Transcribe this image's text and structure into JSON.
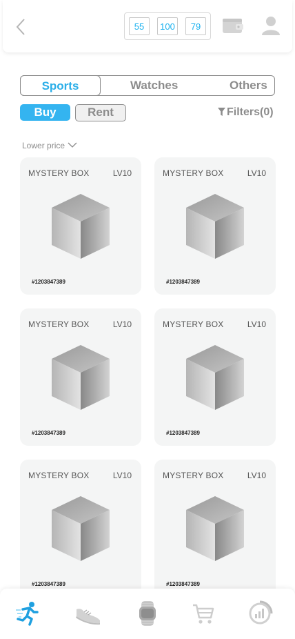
{
  "header": {
    "back_icon": "chevron-left-icon",
    "counters": [
      "55",
      "100",
      "79"
    ],
    "wallet_icon": "wallet-icon",
    "profile_icon": "user-icon"
  },
  "tabs": [
    {
      "label": "Sports",
      "active": true
    },
    {
      "label": "Watches",
      "active": false
    },
    {
      "label": "Others",
      "active": false
    }
  ],
  "mode": {
    "buy_label": "Buy",
    "rent_label": "Rent",
    "selected": "Buy"
  },
  "filters": {
    "label": "Filters(0)",
    "icon": "funnel-icon"
  },
  "sort": {
    "label": "Lower price",
    "icon": "chevron-down-icon"
  },
  "cards": [
    {
      "title": "MYSTERY BOX",
      "level": "LV10",
      "id": "#1203847389",
      "icon": "cube-icon"
    },
    {
      "title": "MYSTERY BOX",
      "level": "LV10",
      "id": "#1203847389",
      "icon": "cube-icon"
    },
    {
      "title": "MYSTERY BOX",
      "level": "LV10",
      "id": "#1203847389",
      "icon": "cube-icon"
    },
    {
      "title": "MYSTERY BOX",
      "level": "LV10",
      "id": "#1203847389",
      "icon": "cube-icon"
    },
    {
      "title": "MYSTERY BOX",
      "level": "LV10",
      "id": "#1203847389",
      "icon": "cube-icon"
    },
    {
      "title": "MYSTERY BOX",
      "level": "LV10",
      "id": "#1203847389",
      "icon": "cube-icon"
    }
  ],
  "bottom_nav": [
    {
      "icon": "runner-icon",
      "active": true
    },
    {
      "icon": "sneaker-icon",
      "active": false
    },
    {
      "icon": "watch-icon",
      "active": false
    },
    {
      "icon": "cart-icon",
      "active": false
    },
    {
      "icon": "stats-icon",
      "active": false
    }
  ],
  "colors": {
    "accent": "#34b4f0",
    "counter_text": "#1ab1ef",
    "card_bg": "#f4f5f5",
    "muted": "#8c8c8c"
  }
}
